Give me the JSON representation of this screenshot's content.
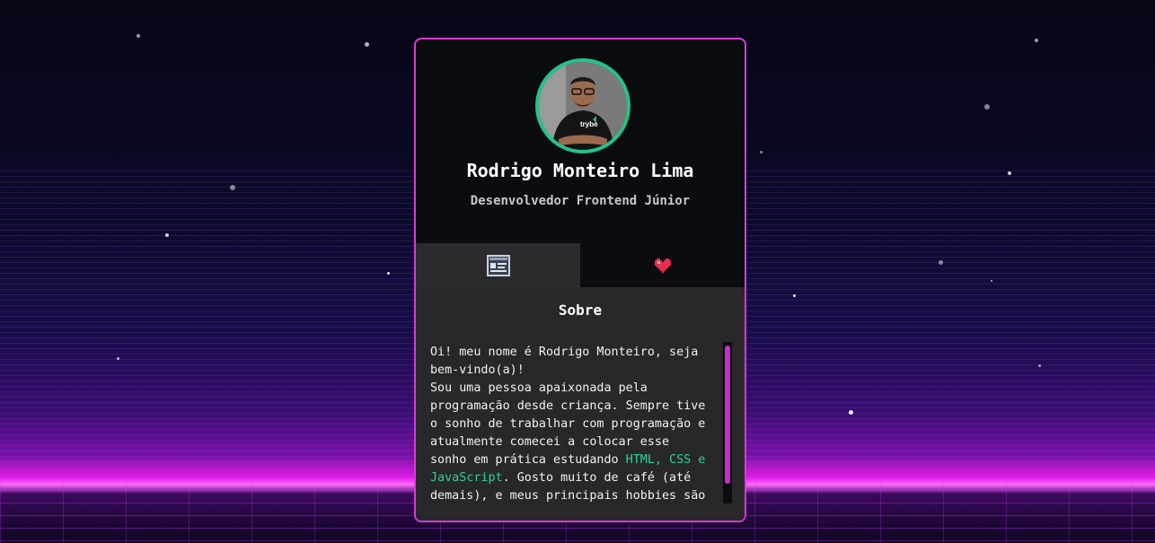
{
  "profile": {
    "name": "Rodrigo Monteiro Lima",
    "role": "Desenvolvedor Frontend Júnior",
    "avatar_shirt_text": "trybe"
  },
  "tabs": [
    {
      "icon": "document-icon",
      "active": true
    },
    {
      "icon": "heart-icon",
      "active": false
    }
  ],
  "about": {
    "title": "Sobre",
    "text_before": "Oi! meu nome é Rodrigo Monteiro, seja\nbem-vindo(a)!\nSou uma pessoa apaixonada pela\nprogramação desde criança. Sempre tive\no sonho de trabalhar com programação e\natualmente comecei a colocar esse\nsonho em prática estudando ",
    "highlight": "HTML, CSS e\nJavaScript",
    "text_after": ". Gosto muito de café (até\ndemais), e meus principais hobbies são"
  },
  "colors": {
    "accent_border": "#d93ad6",
    "avatar_ring": "#23c38a",
    "highlight": "#2fd19a",
    "scrollbar": "#c52cd0"
  }
}
